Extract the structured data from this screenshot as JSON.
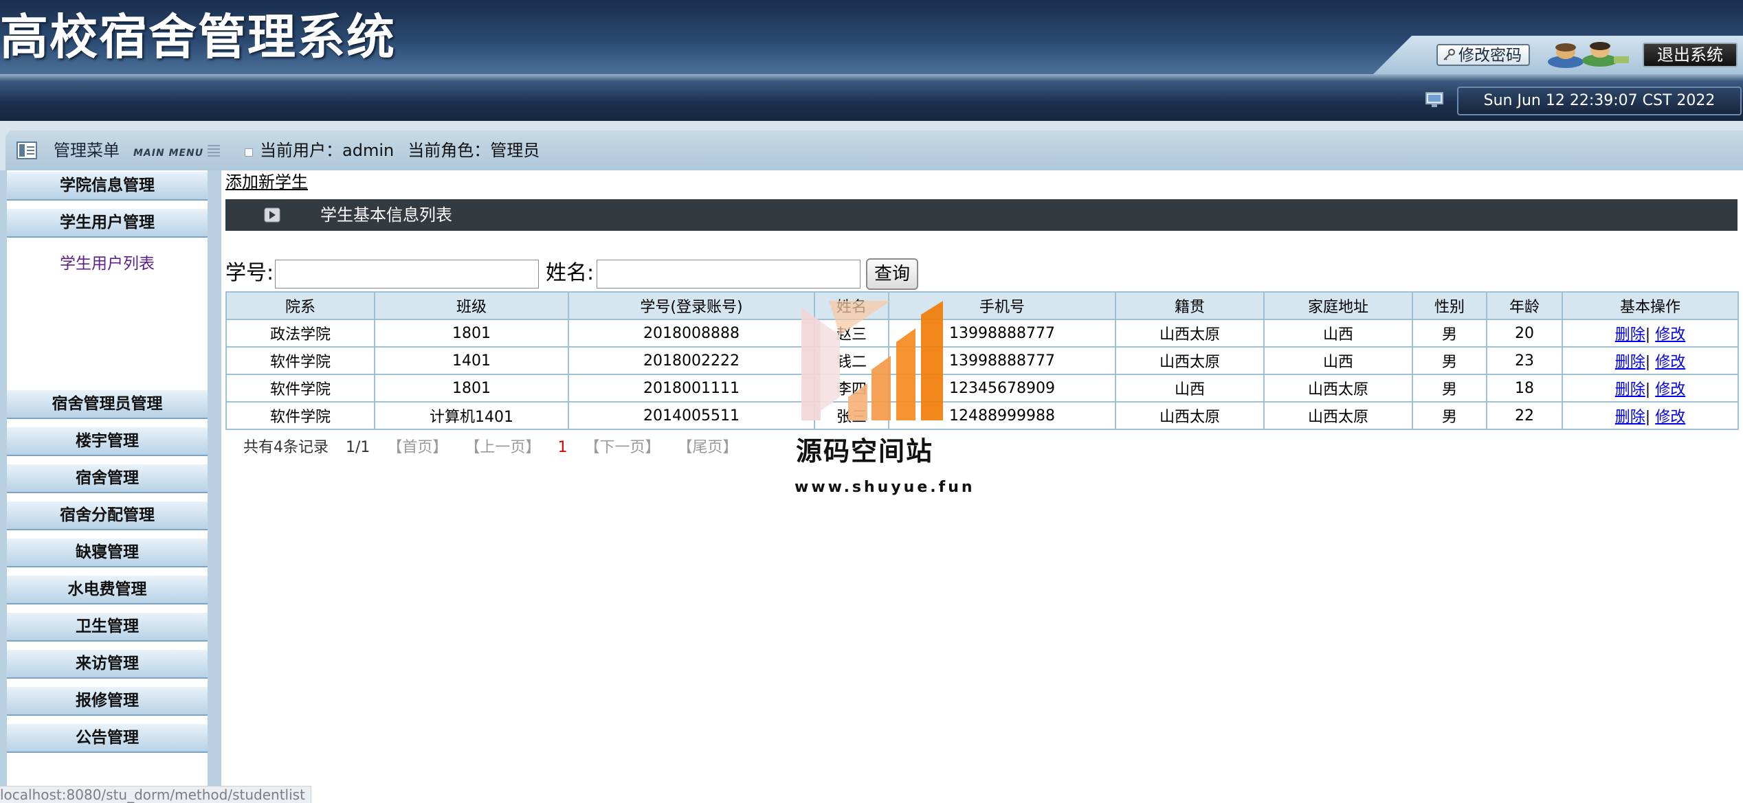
{
  "header": {
    "app_title": "高校宿舍管理系统",
    "change_password_label": "修改密码",
    "logout_label": "退出系统",
    "datetime": "Sun Jun 12 22:39:07 CST 2022"
  },
  "menubar": {
    "title": "管理菜单",
    "subtitle": "MAIN MENU",
    "user_info": {
      "current_user_label": "当前用户：",
      "current_user": "admin",
      "current_role_label": "当前角色：",
      "current_role": "管理员"
    }
  },
  "sidebar": {
    "items": [
      {
        "label": "学院信息管理"
      },
      {
        "label": "学生用户管理"
      },
      {
        "label": "宿舍管理员管理"
      },
      {
        "label": "楼宇管理"
      },
      {
        "label": "宿舍管理"
      },
      {
        "label": "宿舍分配管理"
      },
      {
        "label": "缺寝管理"
      },
      {
        "label": "水电费管理"
      },
      {
        "label": "卫生管理"
      },
      {
        "label": "来访管理"
      },
      {
        "label": "报修管理"
      },
      {
        "label": "公告管理"
      }
    ],
    "sublink": "学生用户列表"
  },
  "main": {
    "add_link": "添加新学生",
    "list_title": "学生基本信息列表",
    "search": {
      "student_no_label": "学号:",
      "student_no_value": "",
      "name_label": "姓名:",
      "name_value": "",
      "button_label": "查询"
    },
    "table": {
      "headers": [
        "院系",
        "班级",
        "学号(登录账号)",
        "姓名",
        "手机号",
        "籍贯",
        "家庭地址",
        "性别",
        "年龄",
        "基本操作"
      ],
      "rows": [
        [
          "政法学院",
          "1801",
          "2018008888",
          "赵三",
          "13998888777",
          "山西太原",
          "山西",
          "男",
          "20"
        ],
        [
          "软件学院",
          "1401",
          "2018002222",
          "钱二",
          "13998888777",
          "山西太原",
          "山西",
          "男",
          "23"
        ],
        [
          "软件学院",
          "1801",
          "2018001111",
          "李四",
          "12345678909",
          "山西",
          "山西太原",
          "男",
          "18"
        ],
        [
          "软件学院",
          "计算机1401",
          "2014005511",
          "张三",
          "12488999988",
          "山西太原",
          "山西太原",
          "男",
          "22"
        ]
      ],
      "delete_label": "删除",
      "separator": "|",
      "edit_label": "修改"
    },
    "pagination": {
      "total": "共有4条记录",
      "page": "1/1",
      "first": "【首页】",
      "prev": "【上一页】",
      "current": "1",
      "next": "【下一页】",
      "last": "【尾页】"
    }
  },
  "watermark": {
    "name": "源码空间站",
    "url": "www.shuyue.fun"
  },
  "status_url": "localhost:8080/stu_dorm/method/studentlist",
  "colors": {
    "header_dark": "#1a2e4c",
    "menubar": "#aec8da",
    "table_border": "#9fc1d6",
    "title_bar": "#333a40",
    "link": "#0000ee"
  }
}
